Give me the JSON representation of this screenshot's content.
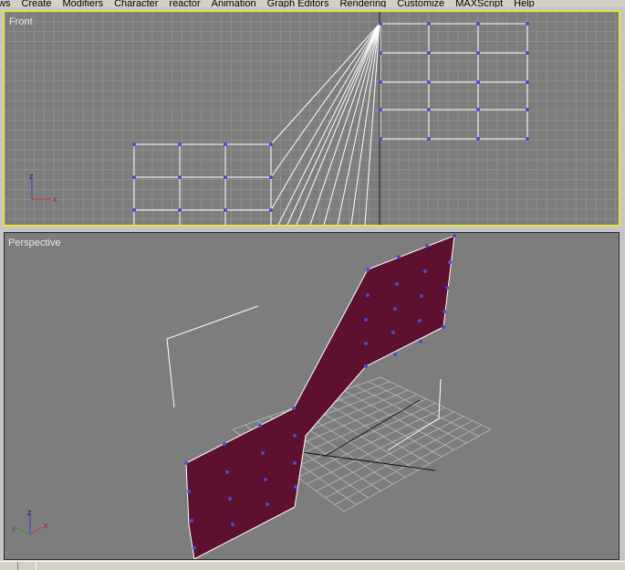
{
  "menu": {
    "items": [
      "ws",
      "Create",
      "Modifiers",
      "Character",
      "reactor",
      "Animation",
      "Graph Editors",
      "Rendering",
      "Customize",
      "MAXScript",
      "Help"
    ]
  },
  "viewports": {
    "front": {
      "label": "Front",
      "active": true
    },
    "perspective": {
      "label": "Perspective"
    }
  },
  "axis": {
    "x": "x",
    "y": "y",
    "z": "z"
  },
  "colors": {
    "viewport_bg": "#7d7d7d",
    "grid": "#8e8e8e",
    "active_border": "#e8e43c",
    "surface": "#5e1030",
    "vertex": "#4a4ad8",
    "wire": "#ffffff"
  }
}
